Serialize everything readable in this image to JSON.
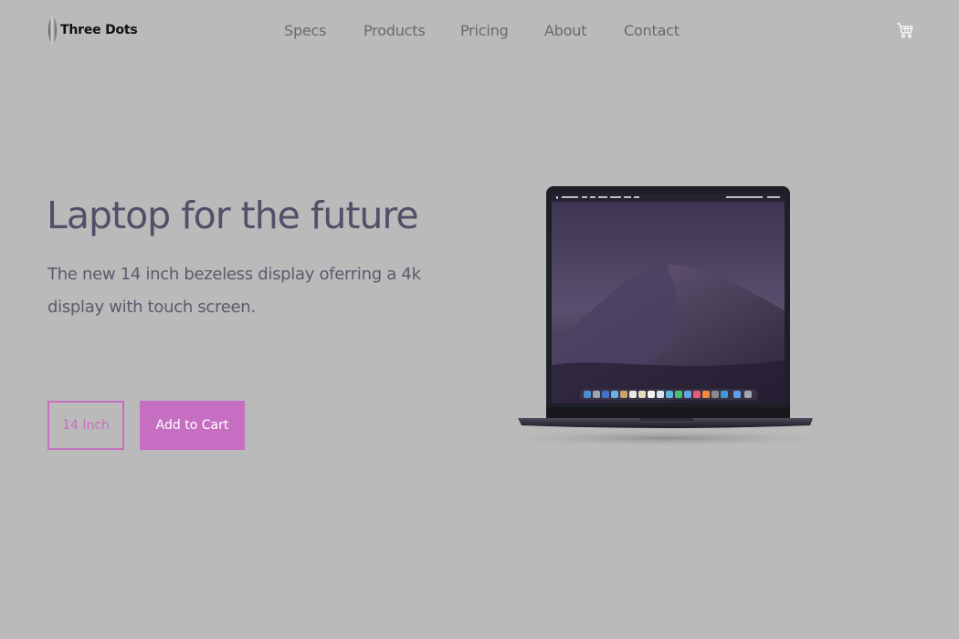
{
  "brand": {
    "name": "Three Dots",
    "logo_icon": "ellipse-logo-icon"
  },
  "nav": {
    "items": [
      {
        "label": "Specs"
      },
      {
        "label": "Products"
      },
      {
        "label": "Pricing"
      },
      {
        "label": "About"
      },
      {
        "label": "Contact"
      }
    ]
  },
  "header": {
    "cart_icon": "shopping-cart-icon"
  },
  "hero": {
    "title": "Laptop for the future",
    "description": "The new 14 inch bezeless display oferring a 4k display with touch screen.",
    "size_button_label": "14 Inch",
    "add_to_cart_label": "Add to Cart",
    "image": "laptop-illustration"
  },
  "colors": {
    "background": "#bababa",
    "accent": "#c66ec2",
    "title_text": "#505068",
    "nav_text": "#6a6a6a"
  }
}
